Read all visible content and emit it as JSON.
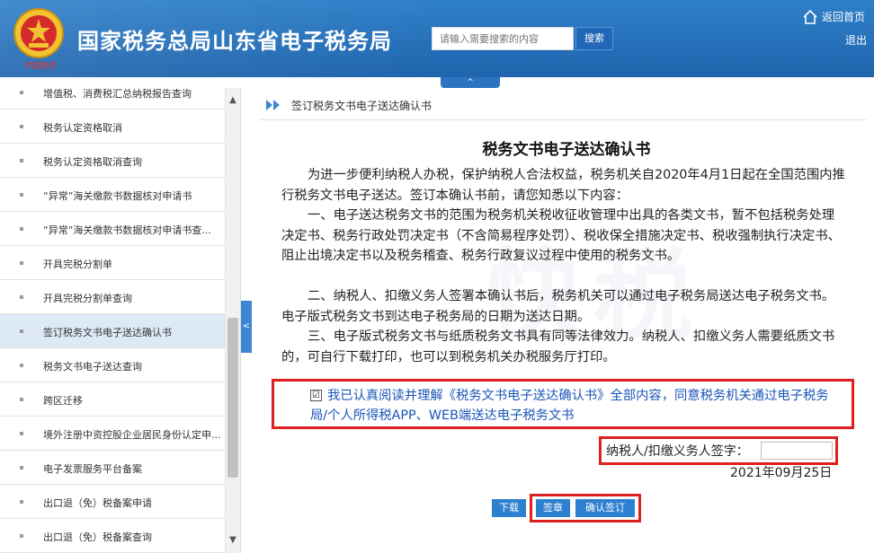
{
  "header": {
    "site_title": "国家税务总局山东省电子税务局",
    "emblem_caption": "中国税务",
    "search_placeholder": "请输入需要搜索的内容",
    "search_button": "搜索",
    "home_link": "返回首页",
    "logout_link": "退出",
    "collapse_tab": "^"
  },
  "sidebar": {
    "items": [
      {
        "label": "增值税、消费税汇总纳税报告查询"
      },
      {
        "label": "税务认定资格取消"
      },
      {
        "label": "税务认定资格取消查询"
      },
      {
        "label": "“异常”海关缴款书数据核对申请书"
      },
      {
        "label": "“异常”海关缴款书数据核对申请书查..."
      },
      {
        "label": "开具完税分割单"
      },
      {
        "label": "开具完税分割单查询"
      },
      {
        "label": "签订税务文书电子送达确认书",
        "active": true
      },
      {
        "label": "税务文书电子送达查询"
      },
      {
        "label": "跨区迁移"
      },
      {
        "label": "境外注册中资控股企业居民身份认定申..."
      },
      {
        "label": "电子发票服务平台备案"
      },
      {
        "label": "出口退（免）税备案申请"
      },
      {
        "label": "出口退（免）税备案查询"
      }
    ],
    "scroll_up": "▲",
    "scroll_down": "▼",
    "toggle": "<"
  },
  "content": {
    "breadcrumb": "签订税务文书电子送达确认书",
    "doc_title": "税务文书电子送达确认书",
    "paragraphs": [
      "为进一步便利纳税人办税，保护纳税人合法权益，税务机关自2020年4月1日起在全国范围内推行税务文书电子送达。签订本确认书前，请您知悉以下内容：",
      "一、电子送达税务文书的范围为税务机关税收征收管理中出具的各类文书，暂不包括税务处理决定书、税务行政处罚决定书（不含简易程序处罚）、税收保全措施决定书、税收强制执行决定书、阻止出境决定书以及税务稽查、税务行政复议过程中使用的税务文书。",
      "二、纳税人、扣缴义务人签署本确认书后，税务机关可以通过电子税务局送达电子税务文书。电子版式税务文书到达电子税务局的日期为送达日期。",
      "三、电子版式税务文书与纸质税务文书具有同等法律效力。纳税人、扣缴义务人需要纸质文书的，可自行下载打印，也可以到税务机关办税服务厅打印。"
    ],
    "consent_check": "☑",
    "consent_text": "我已认真阅读并理解《税务文书电子送达确认书》全部内容，同意税务机关通过电子税务局/个人所得税APP、WEB端送达电子税务文书",
    "sign_label": "纳税人/扣缴义务人签字：",
    "sign_date": "2021年09月25日",
    "buttons": {
      "download": "下载",
      "sign": "签章",
      "confirm": "确认签订"
    }
  },
  "watermark": "快税"
}
